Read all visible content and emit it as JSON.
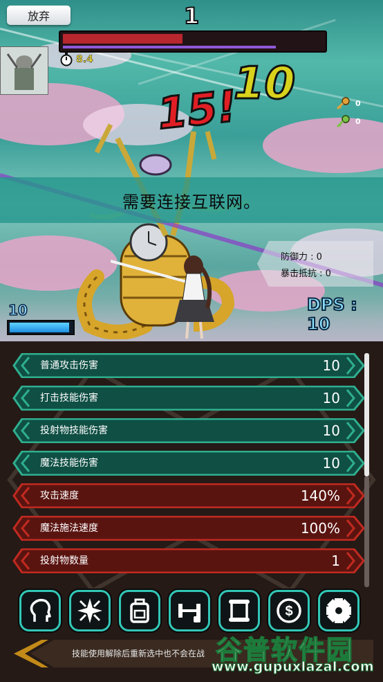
{
  "top": {
    "quit_label": "放弃",
    "stage_number": "1",
    "boss_hp_fraction": 0.46,
    "boss_sub_fraction": 0.82,
    "timer_text": "8.4"
  },
  "damage": {
    "big_red": "15!",
    "yellow": "10"
  },
  "keys": [
    {
      "icon": "gold-key-icon",
      "count": "0"
    },
    {
      "icon": "green-key-icon",
      "count": "0"
    }
  ],
  "notice": "需要连接互联网。",
  "enemy_stats": {
    "defense": "防御力 : 0",
    "strike_resist": "暴击抵抗 : 0"
  },
  "player": {
    "level": "10",
    "level_fill_fraction": 0.95
  },
  "dps_text": "DPS : 10",
  "stats": [
    {
      "label": "普通攻击伤害",
      "value": "10",
      "color": "green"
    },
    {
      "label": "打击技能伤害",
      "value": "10",
      "color": "green"
    },
    {
      "label": "投射物技能伤害",
      "value": "10",
      "color": "green"
    },
    {
      "label": "魔法技能伤害",
      "value": "10",
      "color": "green"
    },
    {
      "label": "攻击速度",
      "value": "140%",
      "color": "red"
    },
    {
      "label": "魔法施法速度",
      "value": "100%",
      "color": "red"
    },
    {
      "label": "投射物数量",
      "value": "1",
      "color": "red"
    }
  ],
  "toolbar": [
    {
      "icon": "head-icon"
    },
    {
      "icon": "sparkle-icon"
    },
    {
      "icon": "backpack-icon"
    },
    {
      "icon": "dumbbell-icon"
    },
    {
      "icon": "scroll-icon"
    },
    {
      "icon": "coin-icon"
    },
    {
      "icon": "gear-icon"
    }
  ],
  "hint_text": "技能使用解除后重新选中也不会在战",
  "watermark": {
    "cn": "谷普软件园",
    "en": "www.gupuxlazal.com"
  },
  "colors": {
    "green_row": "#0f4f44",
    "green_border": "#2fae8e",
    "red_row": "#5a1410",
    "red_border": "#c02a20",
    "tool_border": "#32c7b7"
  }
}
